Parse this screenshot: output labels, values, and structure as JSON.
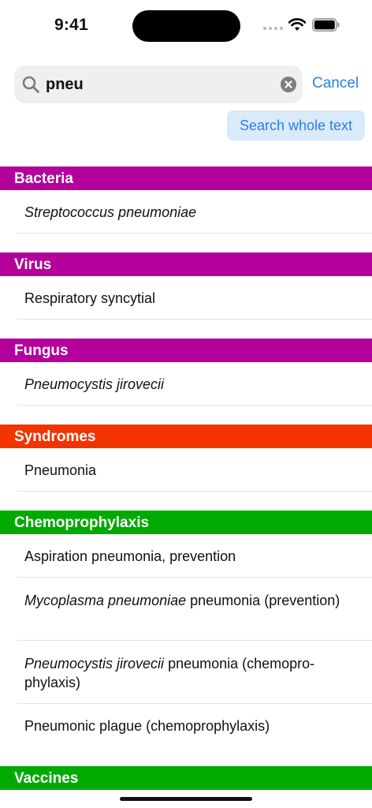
{
  "status_bar": {
    "time": "9:41"
  },
  "search": {
    "query": "pneu",
    "cancel_label": "Cancel",
    "scope_label": "Search whole text"
  },
  "colors": {
    "bacteria": "#b5019b",
    "syndromes": "#f33300",
    "chemo": "#00aa00",
    "accent": "#2b7de9"
  },
  "sections": {
    "bacteria": {
      "title": "Bacteria",
      "items": [
        {
          "italic": "Streptococcus pneumoniae",
          "text": ""
        }
      ]
    },
    "virus": {
      "title": "Virus",
      "items": [
        {
          "italic": "",
          "text": "Respiratory syncytial"
        }
      ]
    },
    "fungus": {
      "title": "Fungus",
      "items": [
        {
          "italic": "Pneumocystis jirovecii",
          "text": ""
        }
      ]
    },
    "syndromes": {
      "title": "Syndromes",
      "items": [
        {
          "italic": "",
          "text": "Pneumonia"
        }
      ]
    },
    "chemoprophylaxis": {
      "title": "Chemoprophylaxis",
      "items": [
        {
          "italic": "",
          "text": "Aspiration pneumonia, prevention"
        },
        {
          "italic": "Mycoplasma pneumoniae",
          "text": " pneumonia (prevention)"
        },
        {
          "italic": "Pneumocystis jirovecii",
          "text": " pneumonia (chemopro-phylaxis)"
        },
        {
          "italic": "",
          "text": "Pneumonic plague (chemoprophylaxis)"
        }
      ]
    },
    "vaccines": {
      "title": "Vaccines"
    }
  }
}
